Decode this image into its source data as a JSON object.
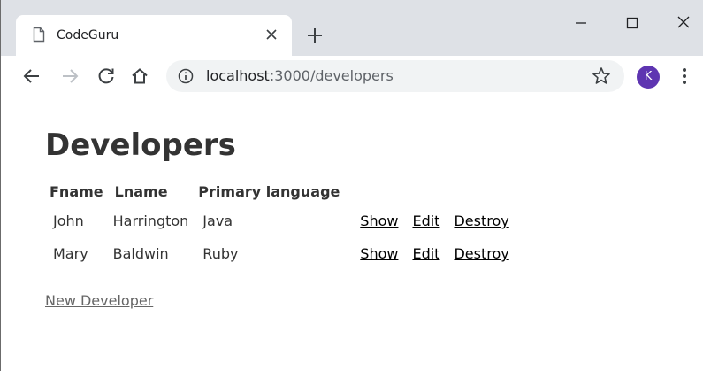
{
  "browser": {
    "tab_title": "CodeGuru",
    "url_host": "localhost",
    "url_path": ":3000/developers",
    "profile_initial": "K",
    "profile_color": "#5e35b1"
  },
  "page": {
    "title": "Developers",
    "columns": [
      "Fname",
      "Lname",
      "Primary language"
    ],
    "rows": [
      {
        "fname": "John",
        "lname": "Harrington",
        "language": "Java",
        "show": "Show",
        "edit": "Edit",
        "destroy": "Destroy"
      },
      {
        "fname": "Mary",
        "lname": "Baldwin",
        "language": "Ruby",
        "show": "Show",
        "edit": "Edit",
        "destroy": "Destroy"
      }
    ],
    "new_link": "New Developer"
  },
  "icons": {
    "tab_page": "page-icon",
    "tab_close": "close-icon",
    "new_tab": "plus-icon",
    "minimize": "minimize-icon",
    "maximize": "maximize-icon",
    "close_window": "close-icon",
    "back": "arrow-left-icon",
    "forward": "arrow-right-icon",
    "reload": "reload-icon",
    "home": "home-icon",
    "info": "info-icon",
    "bookmark": "star-icon",
    "menu": "kebab-menu-icon"
  }
}
